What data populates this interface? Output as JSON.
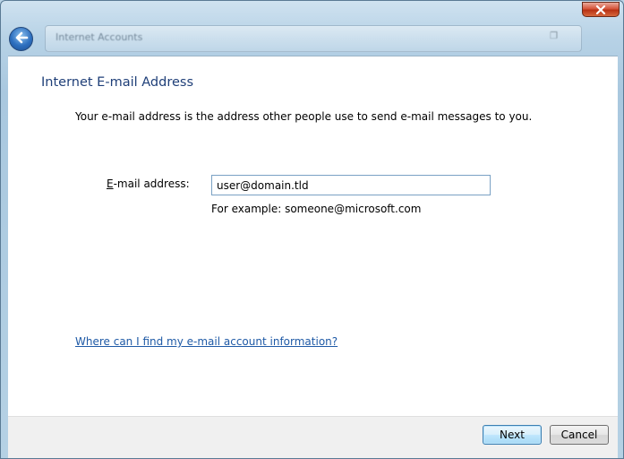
{
  "window": {
    "title": "Internet Accounts"
  },
  "page": {
    "heading": "Internet E-mail Address",
    "intro": "Your e-mail address is the address other people use to send e-mail messages to you.",
    "email_label": "E-mail address:",
    "email_label_access_key": "E",
    "email_label_rest": "-mail address:",
    "email_value": "user@domain.tld",
    "example": "For example: someone@microsoft.com",
    "help_link": "Where can I find my e-mail account information?"
  },
  "footer": {
    "next_label": "Next",
    "cancel_label": "Cancel"
  },
  "colors": {
    "heading": "#1f3f78",
    "link": "#1f5aa6",
    "close_button": "#c8452a",
    "back_button": "#2d6fbf"
  },
  "icons": {
    "back": "back-arrow-icon",
    "close": "close-icon"
  }
}
